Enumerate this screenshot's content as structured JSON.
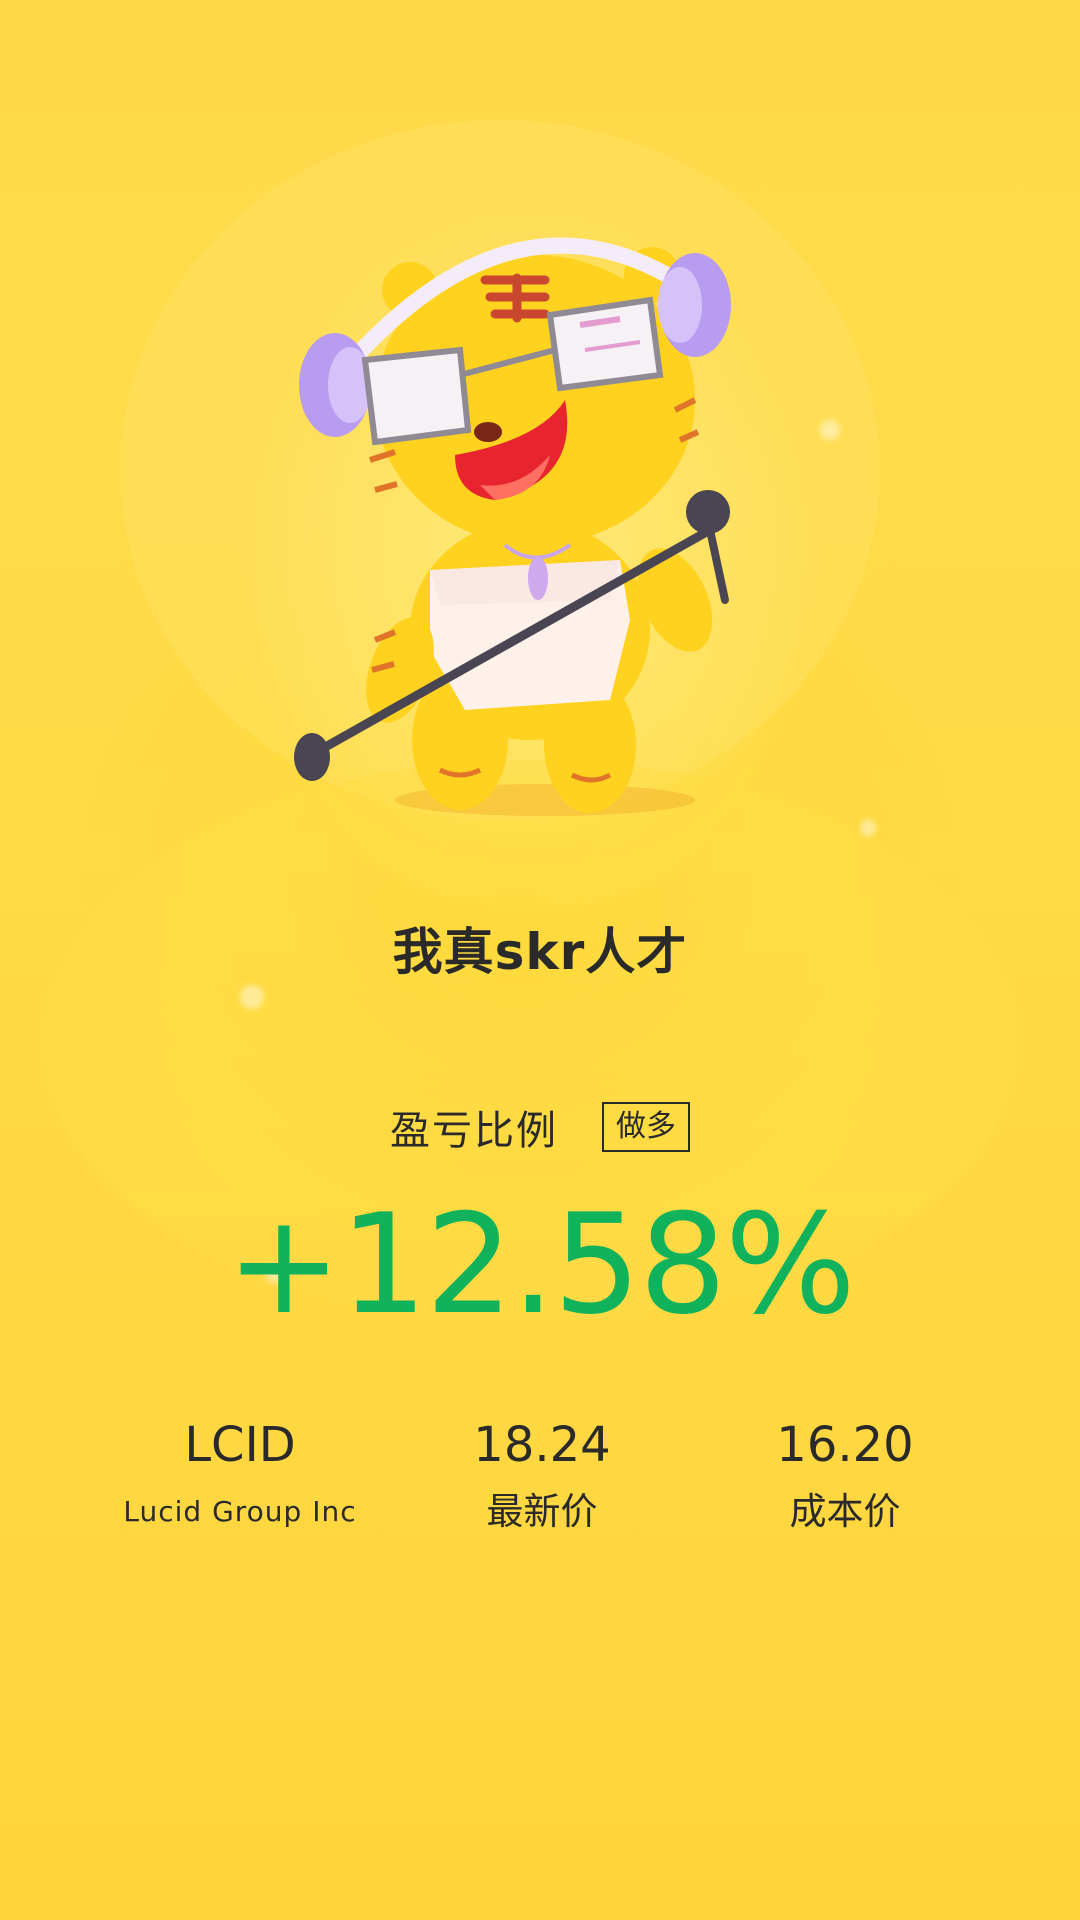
{
  "nickname": "我真skr人才",
  "pnl": {
    "label": "盈亏比例",
    "direction": "做多",
    "value": "+12.58%",
    "color": "#10b25b"
  },
  "stock": {
    "symbol": "LCID",
    "name": "Lucid Group Inc"
  },
  "latest_price": {
    "value": "18.24",
    "label": "最新价"
  },
  "cost_price": {
    "value": "16.20",
    "label": "成本价"
  },
  "colors": {
    "background": "#ffd94a",
    "text": "#2b2a2a",
    "gain": "#10b25b"
  },
  "illustration": "tiger-mascot-with-headphones-and-microphone"
}
